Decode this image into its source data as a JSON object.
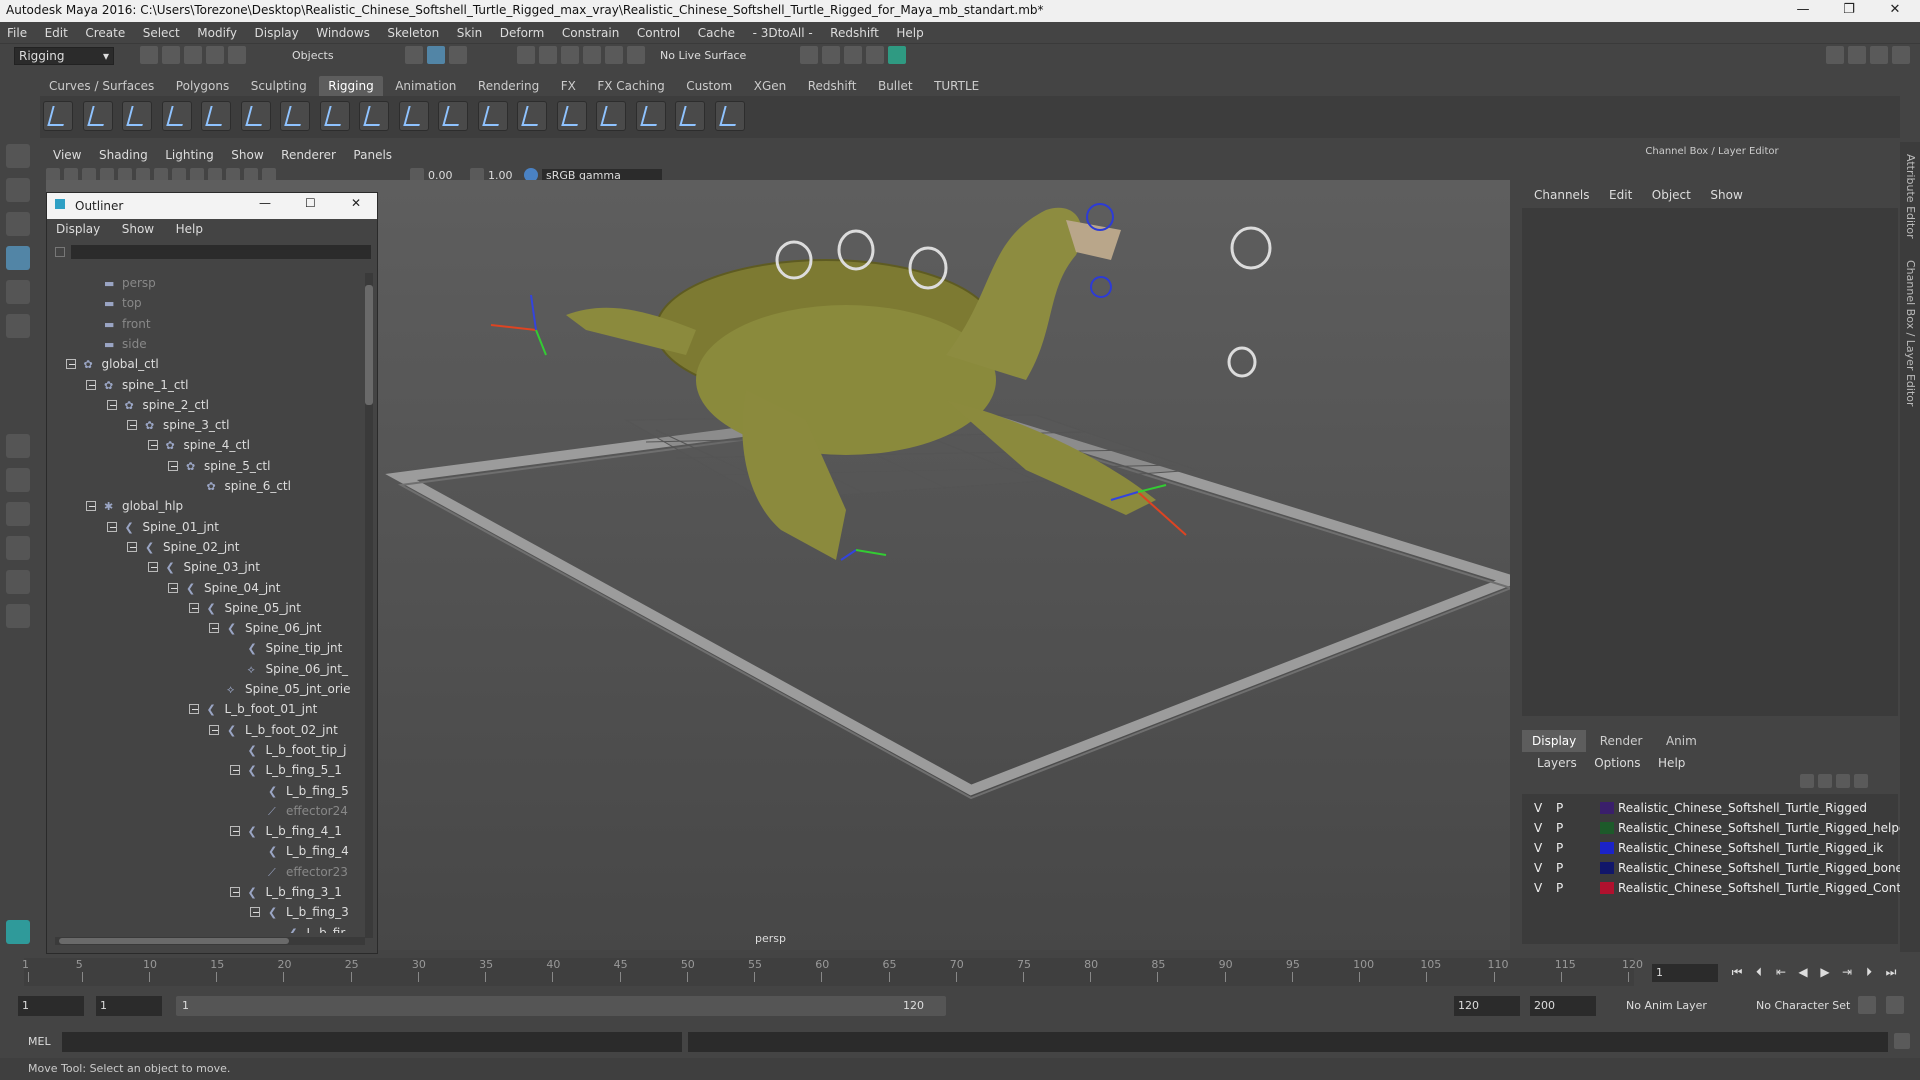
{
  "titlebar": {
    "title": "Autodesk Maya 2016: C:\\Users\\Torezone\\Desktop\\Realistic_Chinese_Softshell_Turtle_Rigged_max_vray\\Realistic_Chinese_Softshell_Turtle_Rigged_for_Maya_mb_standart.mb*",
    "minimize": "—",
    "restore": "❐",
    "close": "✕"
  },
  "menubar": [
    "File",
    "Edit",
    "Create",
    "Select",
    "Modify",
    "Display",
    "Windows",
    "Skeleton",
    "Skin",
    "Deform",
    "Constrain",
    "Control",
    "Cache",
    "- 3DtoAll -",
    "Redshift",
    "Help"
  ],
  "statusline": {
    "mode": "Rigging",
    "selection_mode": "Objects",
    "live_surface": "No Live Surface"
  },
  "shelf": {
    "tabs": [
      "Curves / Surfaces",
      "Polygons",
      "Sculpting",
      "Rigging",
      "Animation",
      "Rendering",
      "FX",
      "FX Caching",
      "Custom",
      "XGen",
      "Redshift",
      "Bullet",
      "TURTLE"
    ],
    "active_tab": "Rigging"
  },
  "viewport": {
    "menu": [
      "View",
      "Shading",
      "Lighting",
      "Show",
      "Renderer",
      "Panels"
    ],
    "near_value": "0.00",
    "far_value": "1.00",
    "color_space": "sRGB gamma",
    "camera_label": "persp",
    "colors": {
      "turtle_body": "#8a8a3c",
      "frame": "#9a9a9a",
      "controls": "#dcdcdc"
    }
  },
  "outliner": {
    "title": "Outliner",
    "menu": [
      "Display",
      "Show",
      "Help"
    ],
    "nodes": [
      {
        "label": "persp",
        "depth": 2,
        "icon": "camera-icon",
        "expand": false,
        "dim": true
      },
      {
        "label": "top",
        "depth": 2,
        "icon": "camera-icon",
        "expand": false,
        "dim": true
      },
      {
        "label": "front",
        "depth": 2,
        "icon": "camera-icon",
        "expand": false,
        "dim": true
      },
      {
        "label": "side",
        "depth": 2,
        "icon": "camera-icon",
        "expand": false,
        "dim": true
      },
      {
        "label": "global_ctl",
        "depth": 1,
        "icon": "curve-icon",
        "expand": true,
        "dim": false
      },
      {
        "label": "spine_1_ctl",
        "depth": 2,
        "icon": "curve-icon",
        "expand": true,
        "dim": false
      },
      {
        "label": "spine_2_ctl",
        "depth": 3,
        "icon": "curve-icon",
        "expand": true,
        "dim": false
      },
      {
        "label": "spine_3_ctl",
        "depth": 4,
        "icon": "curve-icon",
        "expand": true,
        "dim": false
      },
      {
        "label": "spine_4_ctl",
        "depth": 5,
        "icon": "curve-icon",
        "expand": true,
        "dim": false
      },
      {
        "label": "spine_5_ctl",
        "depth": 6,
        "icon": "curve-icon",
        "expand": true,
        "dim": false
      },
      {
        "label": "spine_6_ctl",
        "depth": 7,
        "icon": "curve-icon",
        "expand": false,
        "dim": false
      },
      {
        "label": "global_hlp",
        "depth": 2,
        "icon": "locator-icon",
        "expand": true,
        "dim": false
      },
      {
        "label": "Spine_01_jnt",
        "depth": 3,
        "icon": "joint-icon",
        "expand": true,
        "dim": false
      },
      {
        "label": "Spine_02_jnt",
        "depth": 4,
        "icon": "joint-icon",
        "expand": true,
        "dim": false
      },
      {
        "label": "Spine_03_jnt",
        "depth": 5,
        "icon": "joint-icon",
        "expand": true,
        "dim": false
      },
      {
        "label": "Spine_04_jnt",
        "depth": 6,
        "icon": "joint-icon",
        "expand": true,
        "dim": false
      },
      {
        "label": "Spine_05_jnt",
        "depth": 7,
        "icon": "joint-icon",
        "expand": true,
        "dim": false
      },
      {
        "label": "Spine_06_jnt",
        "depth": 8,
        "icon": "joint-icon",
        "expand": true,
        "dim": false
      },
      {
        "label": "Spine_tip_jnt",
        "depth": 9,
        "icon": "joint-icon",
        "expand": false,
        "dim": false
      },
      {
        "label": "Spine_06_jnt_",
        "depth": 9,
        "icon": "constraint-icon",
        "expand": false,
        "dim": false
      },
      {
        "label": "Spine_05_jnt_orie",
        "depth": 8,
        "icon": "constraint-icon",
        "expand": false,
        "dim": false
      },
      {
        "label": "L_b_foot_01_jnt",
        "depth": 7,
        "icon": "joint-icon",
        "expand": true,
        "dim": false
      },
      {
        "label": "L_b_foot_02_jnt",
        "depth": 8,
        "icon": "joint-icon",
        "expand": true,
        "dim": false
      },
      {
        "label": "L_b_foot_tip_j",
        "depth": 9,
        "icon": "joint-icon",
        "expand": false,
        "dim": false
      },
      {
        "label": "L_b_fing_5_1",
        "depth": 9,
        "icon": "joint-icon",
        "expand": true,
        "dim": false
      },
      {
        "label": "L_b_fing_5",
        "depth": 10,
        "icon": "joint-icon",
        "expand": false,
        "dim": false
      },
      {
        "label": "effector24",
        "depth": 10,
        "icon": "effector-icon",
        "expand": false,
        "dim": true
      },
      {
        "label": "L_b_fing_4_1",
        "depth": 9,
        "icon": "joint-icon",
        "expand": true,
        "dim": false
      },
      {
        "label": "L_b_fing_4",
        "depth": 10,
        "icon": "joint-icon",
        "expand": false,
        "dim": false
      },
      {
        "label": "effector23",
        "depth": 10,
        "icon": "effector-icon",
        "expand": false,
        "dim": true
      },
      {
        "label": "L_b_fing_3_1",
        "depth": 9,
        "icon": "joint-icon",
        "expand": true,
        "dim": false
      },
      {
        "label": "L_b_fing_3",
        "depth": 10,
        "icon": "joint-icon",
        "expand": true,
        "dim": false
      },
      {
        "label": "L_b_fir",
        "depth": 11,
        "icon": "joint-icon",
        "expand": false,
        "dim": false
      }
    ]
  },
  "channel_box": {
    "title": "Channel Box / Layer Editor",
    "menu": [
      "Channels",
      "Edit",
      "Object",
      "Show"
    ],
    "layer_tabs": [
      "Display",
      "Render",
      "Anim"
    ],
    "active_layer_tab": "Display",
    "layer_menu": [
      "Layers",
      "Options",
      "Help"
    ],
    "layers": [
      {
        "v": "V",
        "p": "P",
        "color": "#3a1f6b",
        "name": "Realistic_Chinese_Softshell_Turtle_Rigged"
      },
      {
        "v": "V",
        "p": "P",
        "color": "#1d5a2a",
        "name": "Realistic_Chinese_Softshell_Turtle_Rigged_helper"
      },
      {
        "v": "V",
        "p": "P",
        "color": "#1b23c8",
        "name": "Realistic_Chinese_Softshell_Turtle_Rigged_ik"
      },
      {
        "v": "V",
        "p": "P",
        "color": "#11166a",
        "name": "Realistic_Chinese_Softshell_Turtle_Rigged_bones"
      },
      {
        "v": "V",
        "p": "P",
        "color": "#b0112e",
        "name": "Realistic_Chinese_Softshell_Turtle_Rigged_Control"
      }
    ],
    "side_tabs": [
      "Attribute Editor",
      "Channel Box / Layer Editor"
    ]
  },
  "timeline": {
    "labels": [
      "1",
      "5",
      "10",
      "15",
      "20",
      "25",
      "30",
      "35",
      "40",
      "45",
      "50",
      "55",
      "60",
      "65",
      "70",
      "75",
      "80",
      "85",
      "90",
      "95",
      "100",
      "105",
      "110",
      "115",
      "120"
    ],
    "current_frame": "1"
  },
  "range": {
    "start": "1",
    "inner_start": "1",
    "slider_start": "1",
    "slider_end": "120",
    "end": "120",
    "anim_end": "200",
    "anim_layer": "No Anim Layer",
    "character_set": "No Character Set"
  },
  "cmdline": {
    "label": "MEL"
  },
  "helpline": {
    "text": "Move Tool: Select an object to move."
  }
}
